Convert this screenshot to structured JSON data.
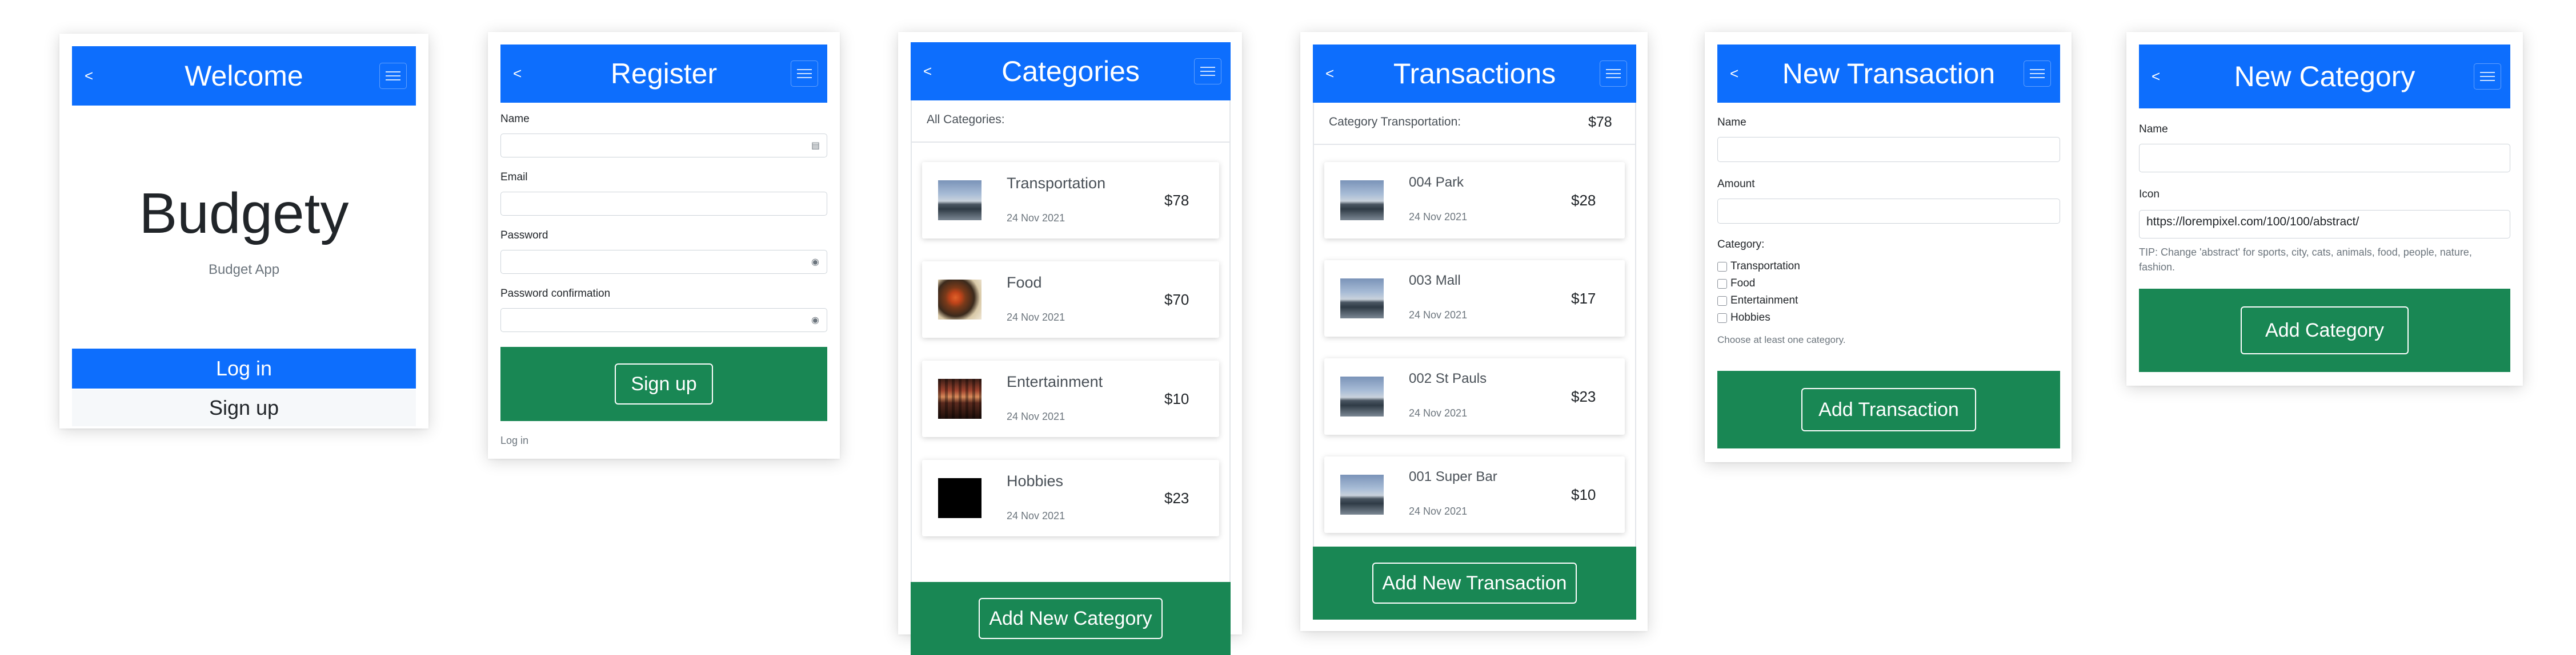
{
  "colors": {
    "primary": "#0d6efd",
    "success": "#198754",
    "light": "#f8f9fa"
  },
  "icons": {
    "back": "chevron-left-icon",
    "menu": "hamburger-menu-icon",
    "card_field": "id-card-icon",
    "eye_field": "eye-icon"
  },
  "nav": {
    "back_glyph": "<"
  },
  "welcome": {
    "header_title": "Welcome",
    "brand": "Budgety",
    "tagline": "Budget App",
    "login_label": "Log in",
    "signup_label": "Sign up"
  },
  "register": {
    "header_title": "Register",
    "fields": [
      {
        "label": "Name",
        "value": ""
      },
      {
        "label": "Email",
        "value": ""
      },
      {
        "label": "Password",
        "value": ""
      },
      {
        "label": "Password confirmation",
        "value": ""
      }
    ],
    "submit_label": "Sign up",
    "login_link": "Log in"
  },
  "categories": {
    "header_title": "Categories",
    "list_title": "All Categories:",
    "items": [
      {
        "name": "Transportation",
        "date": "24 Nov 2021",
        "amount": "$78",
        "icon": "road-photo"
      },
      {
        "name": "Food",
        "date": "24 Nov 2021",
        "amount": "$70",
        "icon": "food-photo"
      },
      {
        "name": "Entertainment",
        "date": "24 Nov 2021",
        "amount": "$10",
        "icon": "entertainment-photo"
      },
      {
        "name": "Hobbies",
        "date": "24 Nov 2021",
        "amount": "$23",
        "icon": "black-image"
      }
    ],
    "add_button": "Add New Category"
  },
  "transactions": {
    "header_title": "Transactions",
    "category_title": "Category Transportation:",
    "category_total": "$78",
    "items": [
      {
        "name": "004 Park",
        "date": "24 Nov 2021",
        "amount": "$28"
      },
      {
        "name": "003 Mall",
        "date": "24 Nov 2021",
        "amount": "$17"
      },
      {
        "name": "002 St Pauls",
        "date": "24 Nov 2021",
        "amount": "$23"
      },
      {
        "name": "001 Super Bar",
        "date": "24 Nov 2021",
        "amount": "$10"
      }
    ],
    "add_button": "Add New Transaction"
  },
  "new_transaction": {
    "header_title": "New Transaction",
    "name_label": "Name",
    "name_value": "",
    "amount_label": "Amount",
    "amount_value": "",
    "category_label": "Category:",
    "options": [
      "Transportation",
      "Food",
      "Entertainment",
      "Hobbies"
    ],
    "hint": "Choose at least one category.",
    "submit_label": "Add Transaction"
  },
  "new_category": {
    "header_title": "New Category",
    "name_label": "Name",
    "name_value": "",
    "icon_label": "Icon",
    "icon_value": "https://lorempixel.com/100/100/abstract/",
    "tip_line1": "TIP: Change 'abstract' for sports, city, cats, animals, food, people, nature,",
    "tip_line2": "fashion.",
    "submit_label": "Add Category"
  }
}
